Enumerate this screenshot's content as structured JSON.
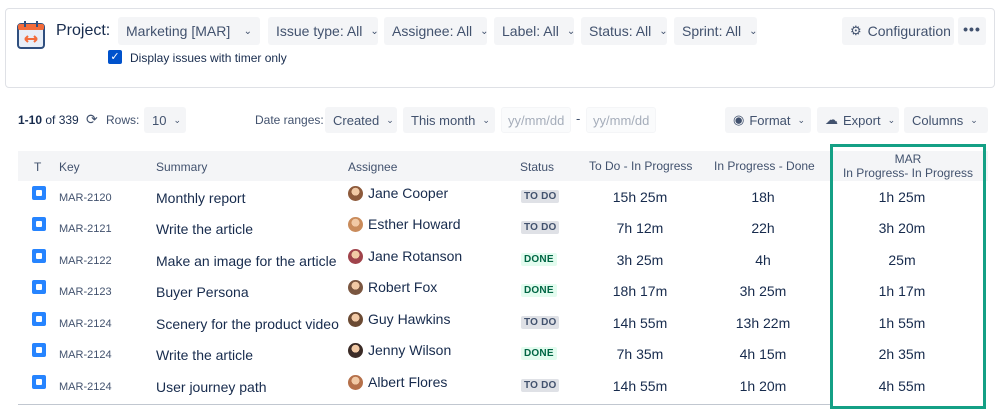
{
  "header": {
    "project_label": "Project:",
    "filters": [
      {
        "label": "Marketing [MAR]"
      },
      {
        "label": "Issue type: All"
      },
      {
        "label": "Assignee: All"
      },
      {
        "label": "Label: All"
      },
      {
        "label": "Status: All"
      },
      {
        "label": "Sprint: All"
      }
    ],
    "configuration_label": "Configuration",
    "more_label": "•••",
    "timer_checkbox_label": "Display issues with timer only",
    "timer_checkbox_checked": true
  },
  "toolbar": {
    "range_bold": "1-10",
    "range_rest": " of 339",
    "rows_label": "Rows:",
    "rows_value": "10",
    "date_ranges_label": "Date ranges:",
    "date_field": "Created",
    "date_period": "This month",
    "date_from_placeholder": "yy/mm/dd",
    "date_separator": "-",
    "date_to_placeholder": "yy/mm/dd",
    "format_label": "Format",
    "export_label": "Export",
    "columns_label": "Columns"
  },
  "table": {
    "headers": {
      "type": "T",
      "key": "Key",
      "summary": "Summary",
      "assignee": "Assignee",
      "status": "Status",
      "todo_inprogress": "To Do - In Progress",
      "inprogress_done": "In Progress - Done",
      "mar_line1": "MAR",
      "mar_line2": "In Progress- In Progress"
    },
    "rows": [
      {
        "key": "MAR-2120",
        "summary": "Monthly report",
        "assignee": "Jane Cooper",
        "avatar_color": "#8d5a3b",
        "status": "TO DO",
        "status_type": "todo",
        "t1": "15h 25m",
        "t2": "18h",
        "t3": "1h 25m"
      },
      {
        "key": "MAR-2121",
        "summary": "Write the article",
        "assignee": "Esther Howard",
        "avatar_color": "#c98b5b",
        "status": "TO DO",
        "status_type": "todo",
        "t1": "7h 12m",
        "t2": "22h",
        "t3": "3h 20m"
      },
      {
        "key": "MAR-2122",
        "summary": "Make an image for the article",
        "assignee": "Jane Rotanson",
        "avatar_color": "#a0434b",
        "status": "DONE",
        "status_type": "done",
        "t1": "3h 25m",
        "t2": "4h",
        "t3": "25m"
      },
      {
        "key": "MAR-2123",
        "summary": "Buyer Persona",
        "assignee": "Robert Fox",
        "avatar_color": "#7a5640",
        "status": "DONE",
        "status_type": "done",
        "t1": "18h 17m",
        "t2": "3h 25m",
        "t3": "1h 17m"
      },
      {
        "key": "MAR-2124",
        "summary": "Scenery for the product video",
        "assignee": "Guy Hawkins",
        "avatar_color": "#6b4a33",
        "status": "TO DO",
        "status_type": "todo",
        "t1": "14h 55m",
        "t2": "13h 22m",
        "t3": "1h 55m"
      },
      {
        "key": "MAR-2124",
        "summary": "Write the article",
        "assignee": "Jenny Wilson",
        "avatar_color": "#3b2b26",
        "status": "DONE",
        "status_type": "done",
        "t1": "7h 35m",
        "t2": "4h 15m",
        "t3": "2h 35m"
      },
      {
        "key": "MAR-2124",
        "summary": "User journey path",
        "assignee": "Albert Flores",
        "avatar_color": "#b5704a",
        "status": "TO DO",
        "status_type": "todo",
        "t1": "14h 55m",
        "t2": "1h 20m",
        "t3": "4h 55m"
      }
    ]
  },
  "colors": {
    "accent": "#0052cc",
    "highlight_border": "#14a085",
    "type_icon": "#2684ff"
  }
}
